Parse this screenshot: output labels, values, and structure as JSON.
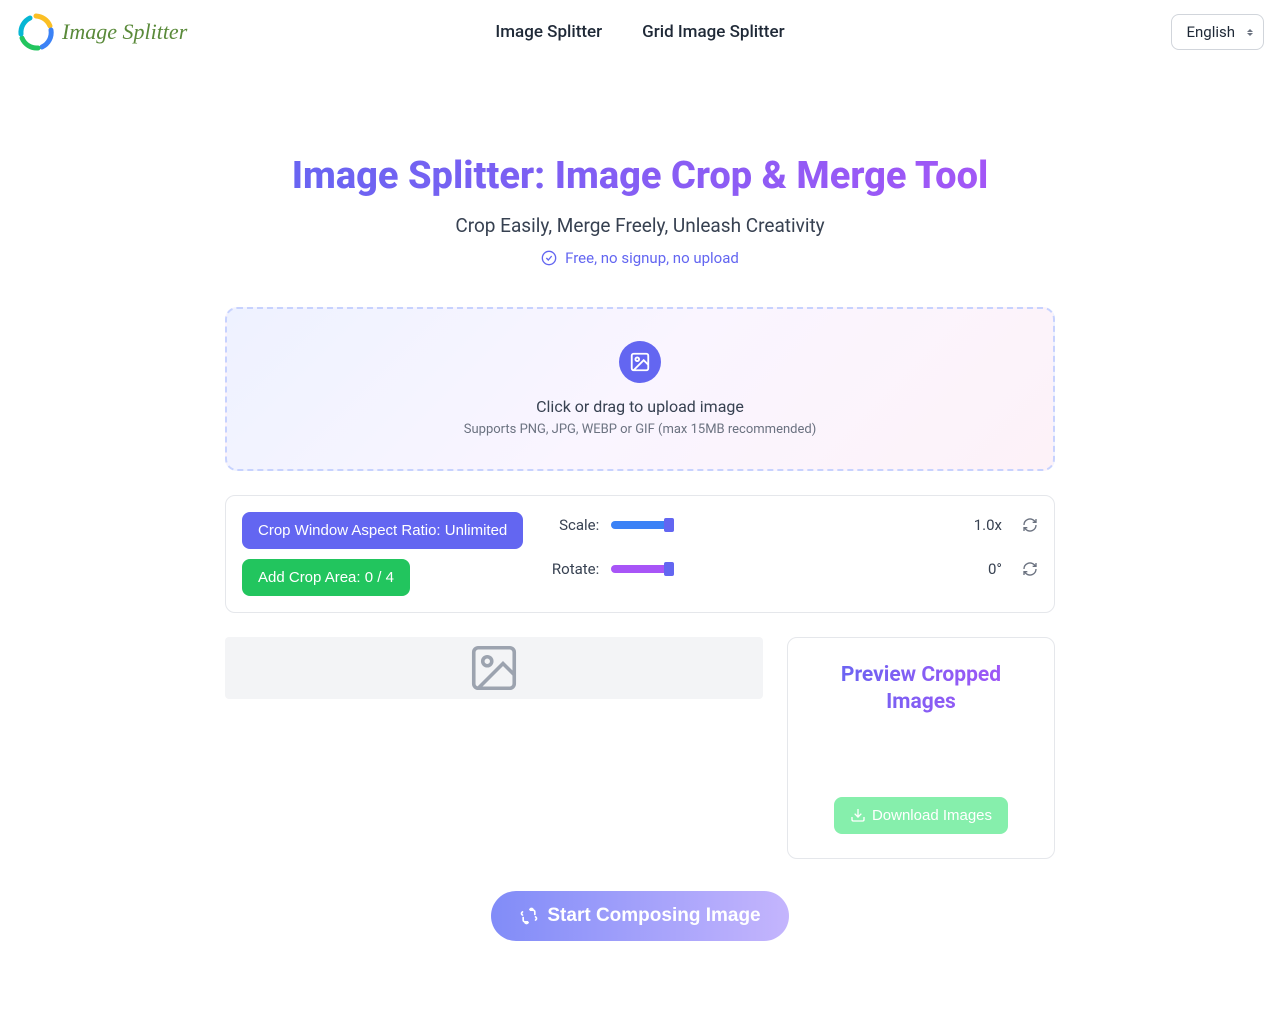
{
  "header": {
    "logo_text": "Image Splitter",
    "nav": [
      {
        "label": "Image Splitter"
      },
      {
        "label": "Grid Image Splitter"
      }
    ],
    "language": "English"
  },
  "hero": {
    "title": "Image Splitter: Image Crop & Merge Tool",
    "subtitle": "Crop Easily, Merge Freely, Unleash Creativity",
    "badge": "Free, no signup, no upload"
  },
  "upload": {
    "text": "Click or drag to upload image",
    "hint": "Supports PNG, JPG, WEBP or GIF (max 15MB recommended)"
  },
  "controls": {
    "aspect_ratio_label": "Crop Window Aspect Ratio: Unlimited",
    "add_crop_label": "Add Crop Area: 0 / 4",
    "scale_label": "Scale:",
    "scale_value": "1.0x",
    "rotate_label": "Rotate:",
    "rotate_value": "0°"
  },
  "preview": {
    "title": "Preview Cropped Images",
    "download_label": "Download Images"
  },
  "compose": {
    "label": "Start Composing Image"
  }
}
